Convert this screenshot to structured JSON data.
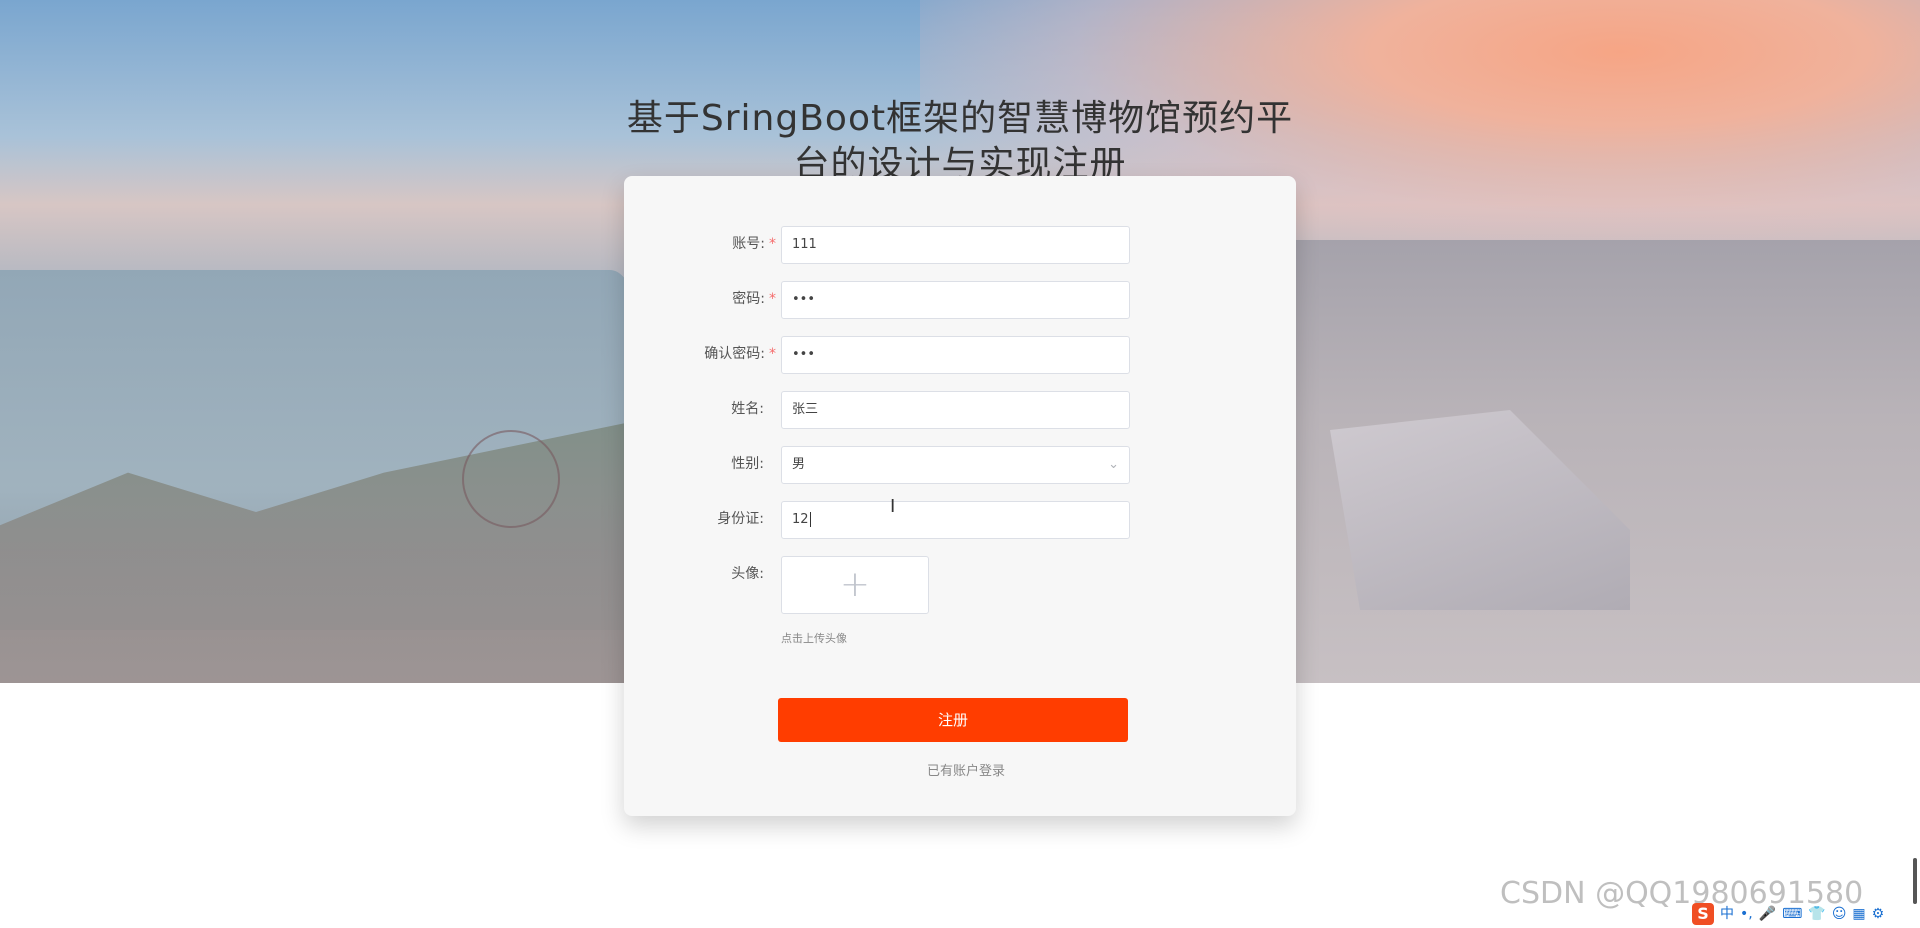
{
  "page": {
    "title": "基于SringBoot框架的智慧博物馆预约平台的设计与实现注册"
  },
  "form": {
    "fields": [
      {
        "label": "账号:",
        "value": "111",
        "required": true
      },
      {
        "label": "密码:",
        "value": "•••",
        "required": true
      },
      {
        "label": "确认密码:",
        "value": "•••",
        "required": true
      },
      {
        "label": "姓名:",
        "value": "张三",
        "required": false
      },
      {
        "label": "性别:",
        "value": "男",
        "required": false
      },
      {
        "label": "身份证:",
        "value": "12",
        "required": false
      }
    ],
    "required_mark": "*",
    "avatar_label": "头像:",
    "avatar_plus": "+",
    "avatar_hint": "点击上传头像",
    "select_chevron": "⌄",
    "submit_label": "注册",
    "login_link": "已有账户登录"
  },
  "watermark": "CSDN @QQ1980691580",
  "ime": {
    "logo": "S",
    "mode": "中",
    "icons": [
      "punctuation-icon",
      "microphone-icon",
      "keyboard-icon",
      "skin-icon",
      "emoji-icon",
      "toolbox-icon",
      "settings-icon"
    ]
  },
  "colors": {
    "accent": "#ff3d00",
    "required": "#f56c6c",
    "title": "#333333"
  }
}
